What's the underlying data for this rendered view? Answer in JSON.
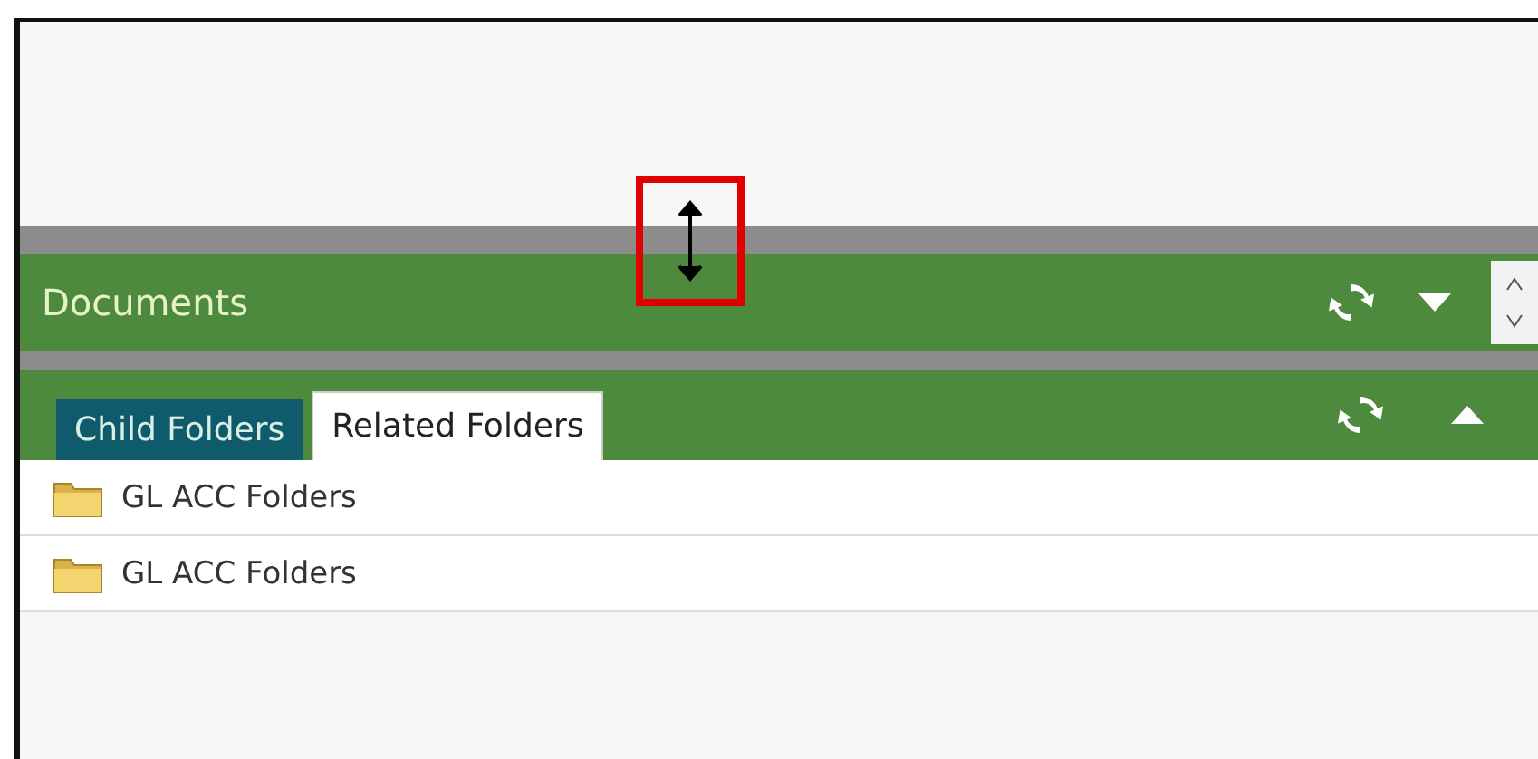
{
  "documents_panel": {
    "title": "Documents",
    "collapsed": true
  },
  "folders_panel": {
    "tabs": [
      {
        "label": "Child Folders",
        "selected": false
      },
      {
        "label": "Related Folders",
        "selected": true
      }
    ],
    "rows": [
      {
        "name": "GL ACC Folders"
      },
      {
        "name": "GL ACC Folders"
      }
    ]
  }
}
